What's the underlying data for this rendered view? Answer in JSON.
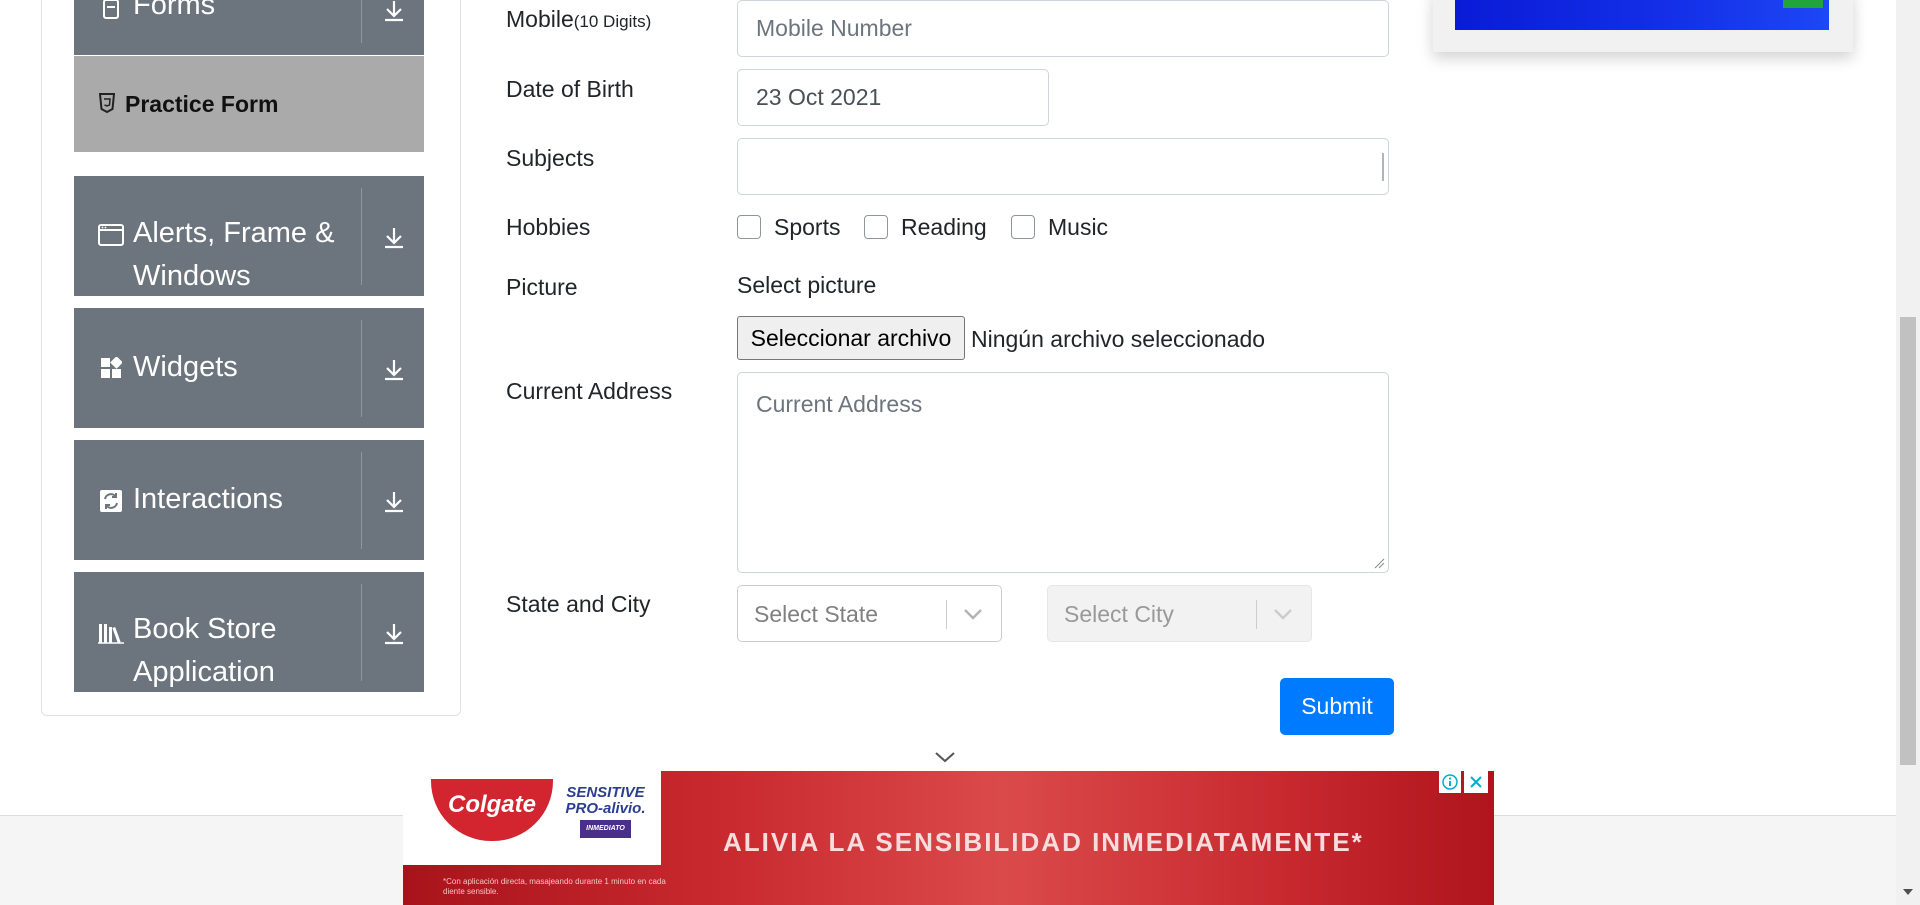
{
  "sidebar": {
    "forms_label": "Forms",
    "practice_form_label": "Practice Form",
    "groups": [
      {
        "label": "Alerts, Frame & Windows",
        "icon": "window-icon"
      },
      {
        "label": "Widgets",
        "icon": "widgets-icon"
      },
      {
        "label": "Interactions",
        "icon": "interactions-icon"
      },
      {
        "label": "Book Store Application",
        "icon": "books-icon"
      }
    ]
  },
  "form": {
    "mobile": {
      "label": "Mobile",
      "hint": "(10 Digits)",
      "placeholder": "Mobile Number"
    },
    "dob": {
      "label": "Date of Birth",
      "value": "23 Oct 2021"
    },
    "subjects": {
      "label": "Subjects",
      "value": ""
    },
    "hobbies": {
      "label": "Hobbies",
      "options": [
        "Sports",
        "Reading",
        "Music"
      ]
    },
    "picture": {
      "label": "Picture",
      "select_text": "Select picture",
      "button_label": "Seleccionar archivo",
      "status": "Ningún archivo seleccionado"
    },
    "address": {
      "label": "Current Address",
      "placeholder": "Current Address"
    },
    "state_city": {
      "label": "State and City",
      "state_placeholder": "Select State",
      "city_placeholder": "Select City"
    },
    "submit_label": "Submit"
  },
  "ads": {
    "bottom": {
      "brand": "Colgate",
      "product_line1": "SENSITIVE",
      "product_line2": "PRO-alivio.",
      "product_tag": "INMEDIATO",
      "headline": "ALIVIA LA SENSIBILIDAD INMEDIATAMENTE*",
      "fine_print": "*Con aplicación directa, masajeando durante 1 minuto en cada diente sensible."
    }
  },
  "colors": {
    "primary": "#007bff",
    "sidebar": "#6c757d",
    "active_item": "#aaaaaa",
    "ad_red": "#c92a2f"
  }
}
